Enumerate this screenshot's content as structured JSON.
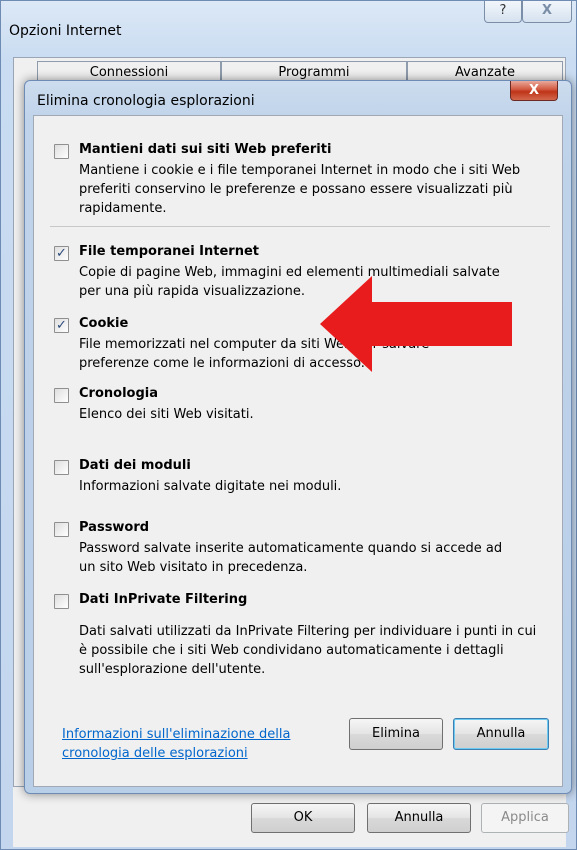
{
  "outer": {
    "title": "Opzioni Internet",
    "help_glyph": "?",
    "close_glyph": "X",
    "tabs": [
      "Connessioni",
      "Programmi",
      "Avanzate"
    ],
    "ok_label": "OK",
    "cancel_label": "Annulla",
    "apply_label": "Applica"
  },
  "dialog": {
    "title": "Elimina cronologia esplorazioni",
    "close_glyph": "X",
    "options": [
      {
        "title": "Mantieni dati sui siti Web preferiti",
        "checked": false,
        "desc_lines": [
          "Mantiene i cookie e i file temporanei Internet in modo che i siti Web",
          "preferiti conservino le preferenze e possano essere visualizzati più",
          "rapidamente."
        ]
      },
      {
        "title": "File temporanei Internet",
        "checked": true,
        "desc_lines": [
          "Copie di pagine Web, immagini ed elementi multimediali salvate",
          "per una più rapida visualizzazione."
        ]
      },
      {
        "title": "Cookie",
        "checked": true,
        "desc_lines": [
          "File memorizzati nel computer da siti Web per salvare",
          "preferenze come le informazioni di accesso."
        ]
      },
      {
        "title": "Cronologia",
        "checked": false,
        "desc_lines": [
          "Elenco dei siti Web visitati."
        ]
      },
      {
        "title": "Dati dei moduli",
        "checked": false,
        "desc_lines": [
          "Informazioni salvate digitate nei moduli."
        ]
      },
      {
        "title": "Password",
        "checked": false,
        "desc_lines": [
          "Password salvate inserite automaticamente quando si accede ad",
          "un sito Web visitato in precedenza."
        ]
      },
      {
        "title": "Dati InPrivate Filtering",
        "checked": false,
        "desc_lines": [
          "Dati salvati utilizzati da InPrivate Filtering per individuare i punti in cui",
          "è possibile che i siti Web condividano automaticamente i dettagli",
          "sull'esplorazione dell'utente."
        ]
      }
    ],
    "info_link_lines": [
      "Informazioni sull'eliminazione della",
      "cronologia delle esplorazioni"
    ],
    "delete_label": "Elimina",
    "cancel_label": "Annulla"
  },
  "colors": {
    "annotation_arrow": "#e81c1c",
    "link": "#0066cc"
  },
  "icons": {
    "help": "help-icon",
    "close": "close-icon",
    "checkmark": "checkmark-icon",
    "annotation": "red-arrow-annotation"
  }
}
